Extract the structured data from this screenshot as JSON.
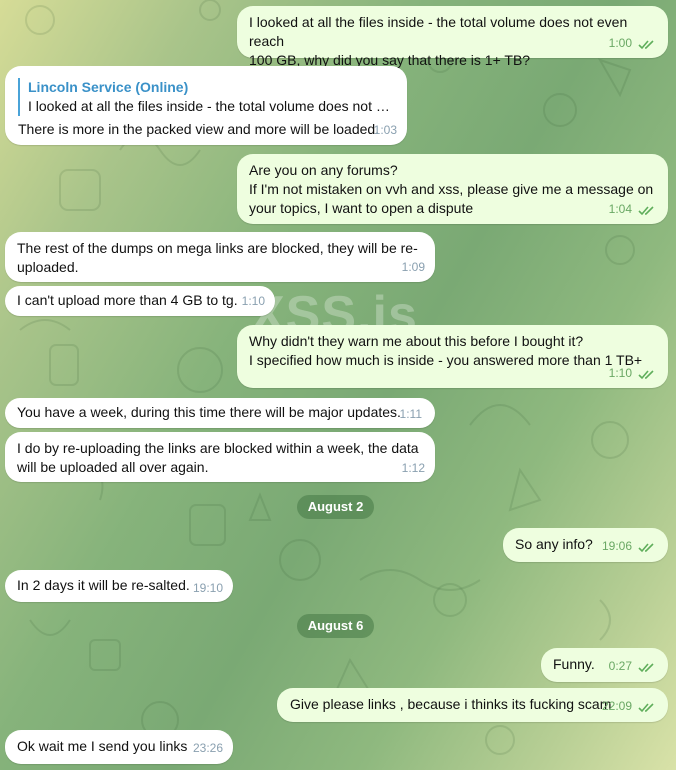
{
  "watermark": "XSS.is",
  "messages": [
    {
      "id": "m1",
      "dir": "out",
      "text": "I looked at all the files inside - the total volume does not even reach\n100 GB, why did you say that there is 1+ TB?",
      "time": "1:00"
    },
    {
      "id": "m2",
      "dir": "in",
      "reply_name": "Lincoln Service (Online)",
      "reply_text": "I looked at all the files inside - the total volume does not eve...",
      "text": "There is more in the packed view and more will be loaded.",
      "time": "1:03"
    },
    {
      "id": "m3",
      "dir": "out",
      "text": "Are you on any forums?\nIf I'm not mistaken on vvh and xss, please give me a message on\nyour topics, I want to open a dispute",
      "time": "1:04"
    },
    {
      "id": "m4",
      "dir": "in",
      "text": "The rest of the dumps on mega links are blocked, they will be re-\nuploaded.",
      "time": "1:09"
    },
    {
      "id": "m5",
      "dir": "in",
      "text": "I can't upload more than 4 GB to tg.",
      "time": "1:10"
    },
    {
      "id": "m6",
      "dir": "out",
      "text": "Why didn't they warn me about this before I bought it?\nI specified how much is inside - you answered more than 1 TB+",
      "time": "1:10"
    },
    {
      "id": "m7",
      "dir": "in",
      "text": "You have a week, during this time there will be major updates.",
      "time": "1:11"
    },
    {
      "id": "m8",
      "dir": "in",
      "text": "I do by re-uploading the links are blocked within a week, the data\nwill be uploaded all over again.",
      "time": "1:12"
    },
    {
      "id": "m9",
      "dir": "out",
      "text": "So any info?",
      "time": "19:06"
    },
    {
      "id": "m10",
      "dir": "in",
      "text": "In 2 days it will be re-salted.",
      "time": "19:10"
    },
    {
      "id": "m11",
      "dir": "out",
      "text": "Funny.",
      "time": "0:27"
    },
    {
      "id": "m12",
      "dir": "out",
      "text": "Give please links , because i thinks its fucking scam",
      "time": "22:09"
    },
    {
      "id": "m13",
      "dir": "in",
      "text": "Ok wait me I send you links",
      "time": "23:26"
    }
  ],
  "dates": {
    "d1": "August 2",
    "d2": "August 6"
  },
  "colors": {
    "incoming": "#ffffff",
    "outgoing": "#eefedf",
    "accent": "#3a91c8",
    "read_ticks": "#5fae5b"
  }
}
